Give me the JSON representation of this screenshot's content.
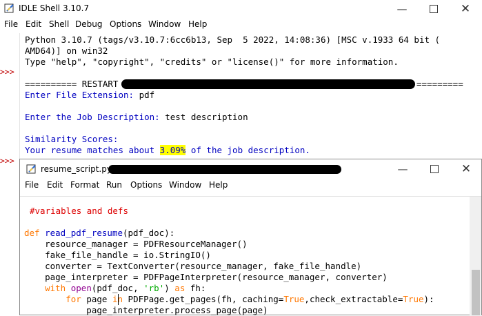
{
  "shell": {
    "title": "IDLE Shell 3.10.7",
    "menu": [
      "File",
      "Edit",
      "Shell",
      "Debug",
      "Options",
      "Window",
      "Help"
    ],
    "prompt": ">>>",
    "lines": {
      "l1": "Python 3.10.7 (tags/v3.10.7:6cc6b13, Sep  5 2022, 14:08:36) [MSC v.1933 64 bit (",
      "l2": "AMD64)] on win32",
      "l3": "Type \"help\", \"copyright\", \"credits\" or \"license()\" for more information.",
      "restart_prefix": "========== RESTART",
      "restart_suffix": "=========",
      "ext_prompt": "Enter File Extension:",
      "ext_value": " pdf",
      "job_prompt": "Enter the Job Description:",
      "job_value": " test description",
      "sim_heading": "Similarity Scores:",
      "match_prefix": "Your resume matches about ",
      "match_value": "3.09%",
      "match_suffix": " of the job description."
    }
  },
  "editor": {
    "title": "resume_script.py -",
    "menu": [
      "File",
      "Edit",
      "Format",
      "Run",
      "Options",
      "Window",
      "Help"
    ],
    "code": {
      "c1": "#variables and defs",
      "c2_kw": "def",
      "c2_name": " read_pdf_resume",
      "c2_rest": "(pdf_doc):",
      "c3": "    resource_manager = PDFResourceManager()",
      "c4": "    fake_file_handle = io.StringIO()",
      "c5": "    converter = TextConverter(resource_manager, fake_file_handle)",
      "c6": "    page_interpreter = PDFPageInterpreter(resource_manager, converter)",
      "c7_kw": "    with",
      "c7_bi": " open",
      "c7_a": "(pdf_doc, ",
      "c7_str": "'rb'",
      "c7_b": ") ",
      "c7_kw2": "as",
      "c7_c": " fh:",
      "c8_kw": "        for",
      "c8_a": " page ",
      "c8_kw2": "in",
      "c8_b": " PDFPage.get_pages(fh, caching=",
      "c8_kw3": "True",
      "c8_c": ",check_extractable=",
      "c8_kw4": "True",
      "c8_d": "):",
      "c9": "            page_interpreter.process_page(page)"
    }
  },
  "icons": {
    "app": "idle-feather-icon",
    "minimize": "minimize-icon",
    "maximize": "maximize-icon",
    "close": "close-icon"
  },
  "colors": {
    "prompt": "#c00000",
    "output_blue": "#0000c0",
    "keyword": "#ff7700",
    "string": "#00aa00",
    "comment": "#dd0000",
    "builtin": "#900090",
    "highlight": "#ffff00"
  }
}
